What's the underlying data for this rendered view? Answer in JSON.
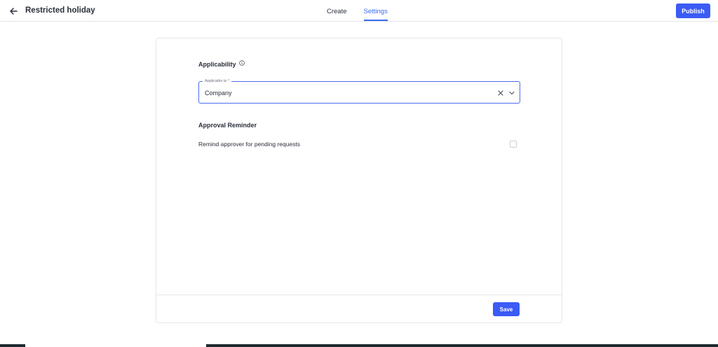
{
  "header": {
    "title": "Restricted holiday",
    "tabs": [
      {
        "label": "Create",
        "active": false
      },
      {
        "label": "Settings",
        "active": true
      }
    ],
    "publish_label": "Publish"
  },
  "applicability": {
    "title": "Applicability",
    "field_label": "Applicable to *",
    "field_value": "Company"
  },
  "approval_reminder": {
    "title": "Approval Reminder",
    "option_label": "Remind approver for pending requests",
    "checked": false
  },
  "footer": {
    "save_label": "Save"
  },
  "colors": {
    "accent": "#3b5bf5",
    "active_tab": "#3b6cf0",
    "border": "#e3e6ec"
  },
  "icons": [
    "back-arrow-icon",
    "info-icon",
    "clear-icon",
    "chevron-down-icon"
  ]
}
